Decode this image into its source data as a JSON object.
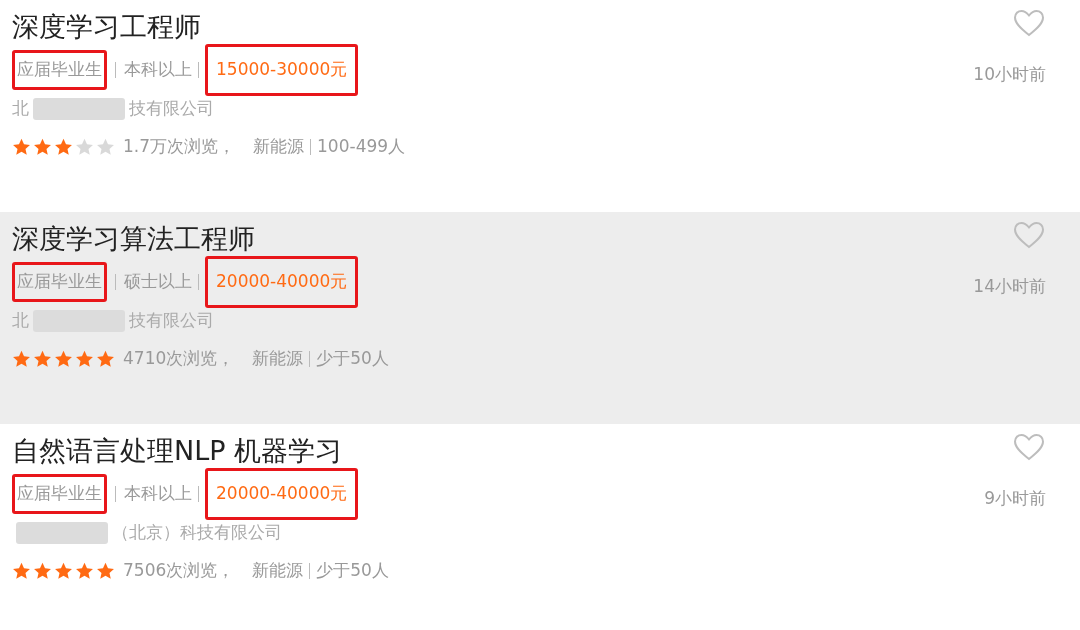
{
  "jobs": [
    {
      "title": "深度学习工程师",
      "hovered": false,
      "experience": "应届毕业生",
      "experience_marked": true,
      "education": "本科以上",
      "salary": "15000-30000元",
      "salary_marked": true,
      "posted": "10小时前",
      "favorited": false,
      "company": [
        {
          "kind": "text",
          "text": "北"
        },
        {
          "kind": "redacted"
        },
        {
          "kind": "text",
          "text": "技有限公司"
        }
      ],
      "stars": 3,
      "views": "1.7万次浏览，",
      "industry": "新能源",
      "size": "100-499人"
    },
    {
      "title": "深度学习算法工程师",
      "hovered": true,
      "experience": "应届毕业生",
      "experience_marked": true,
      "education": "硕士以上",
      "salary": "20000-40000元",
      "salary_marked": true,
      "posted": "14小时前",
      "favorited": false,
      "company": [
        {
          "kind": "text",
          "text": "北"
        },
        {
          "kind": "redacted"
        },
        {
          "kind": "text",
          "text": "技有限公司"
        }
      ],
      "stars": 5,
      "views": "4710次浏览，",
      "industry": "新能源",
      "size": "少于50人"
    },
    {
      "title": "自然语言处理NLP 机器学习",
      "hovered": false,
      "experience": "应届毕业生",
      "experience_marked": true,
      "education": "本科以上",
      "salary": "20000-40000元",
      "salary_marked": true,
      "posted": "9小时前",
      "favorited": false,
      "company": [
        {
          "kind": "redacted"
        },
        {
          "kind": "text",
          "text": "（北京）科技有限公司"
        }
      ],
      "stars": 5,
      "views": "7506次浏览，",
      "industry": "新能源",
      "size": "少于50人"
    }
  ]
}
